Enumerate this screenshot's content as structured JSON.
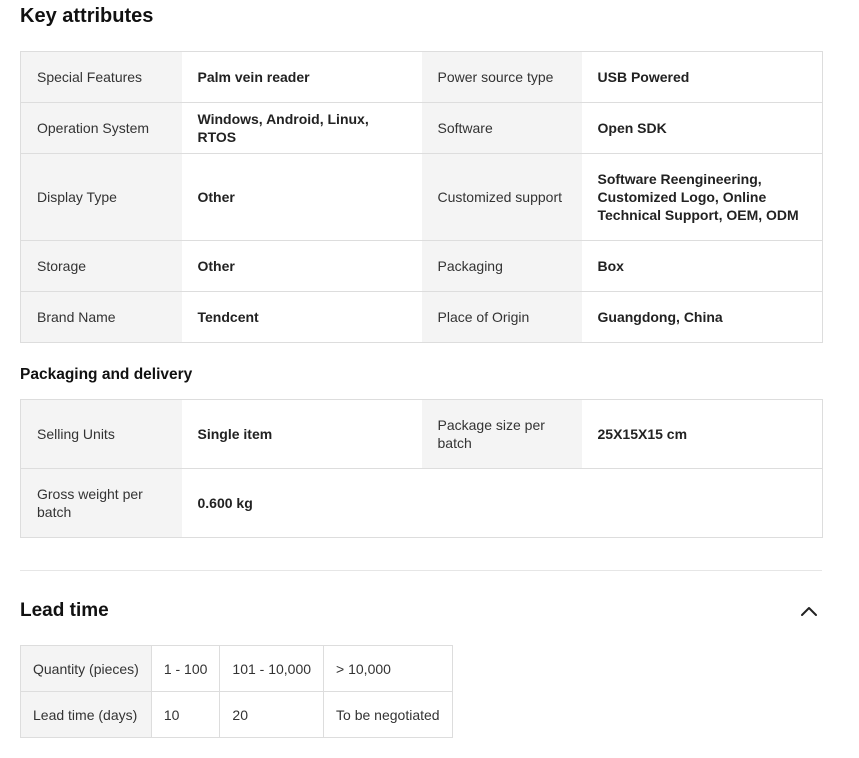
{
  "key_attributes": {
    "title": "Key attributes",
    "rows": [
      {
        "k1": "Special Features",
        "v1": "Palm vein reader",
        "k2": "Power source type",
        "v2": "USB Powered"
      },
      {
        "k1": "Operation System",
        "v1": "Windows, Android, Linux, RTOS",
        "k2": "Software",
        "v2": "Open SDK"
      },
      {
        "k1": "Display Type",
        "v1": "Other",
        "k2": "Customized support",
        "v2": "Software Reengineering, Customized Logo, Online Technical Support, OEM, ODM"
      },
      {
        "k1": "Storage",
        "v1": "Other",
        "k2": "Packaging",
        "v2": "Box"
      },
      {
        "k1": "Brand Name",
        "v1": "Tendcent",
        "k2": "Place of Origin",
        "v2": "Guangdong, China"
      }
    ]
  },
  "packaging": {
    "title": "Packaging and delivery",
    "rows": [
      {
        "k1": "Selling Units",
        "v1": "Single item",
        "k2": "Package size per batch",
        "v2": "25X15X15 cm"
      },
      {
        "k1": "Gross weight per batch",
        "v1": "0.600 kg"
      }
    ]
  },
  "lead_time": {
    "title": "Lead time",
    "toggle_icon": "chevron-up-icon",
    "quantity_label": "Quantity (pieces)",
    "quantities": [
      "1 - 100",
      "101 - 10,000",
      "> 10,000"
    ],
    "days_label": "Lead time (days)",
    "days": [
      "10",
      "20",
      "To be negotiated"
    ]
  }
}
